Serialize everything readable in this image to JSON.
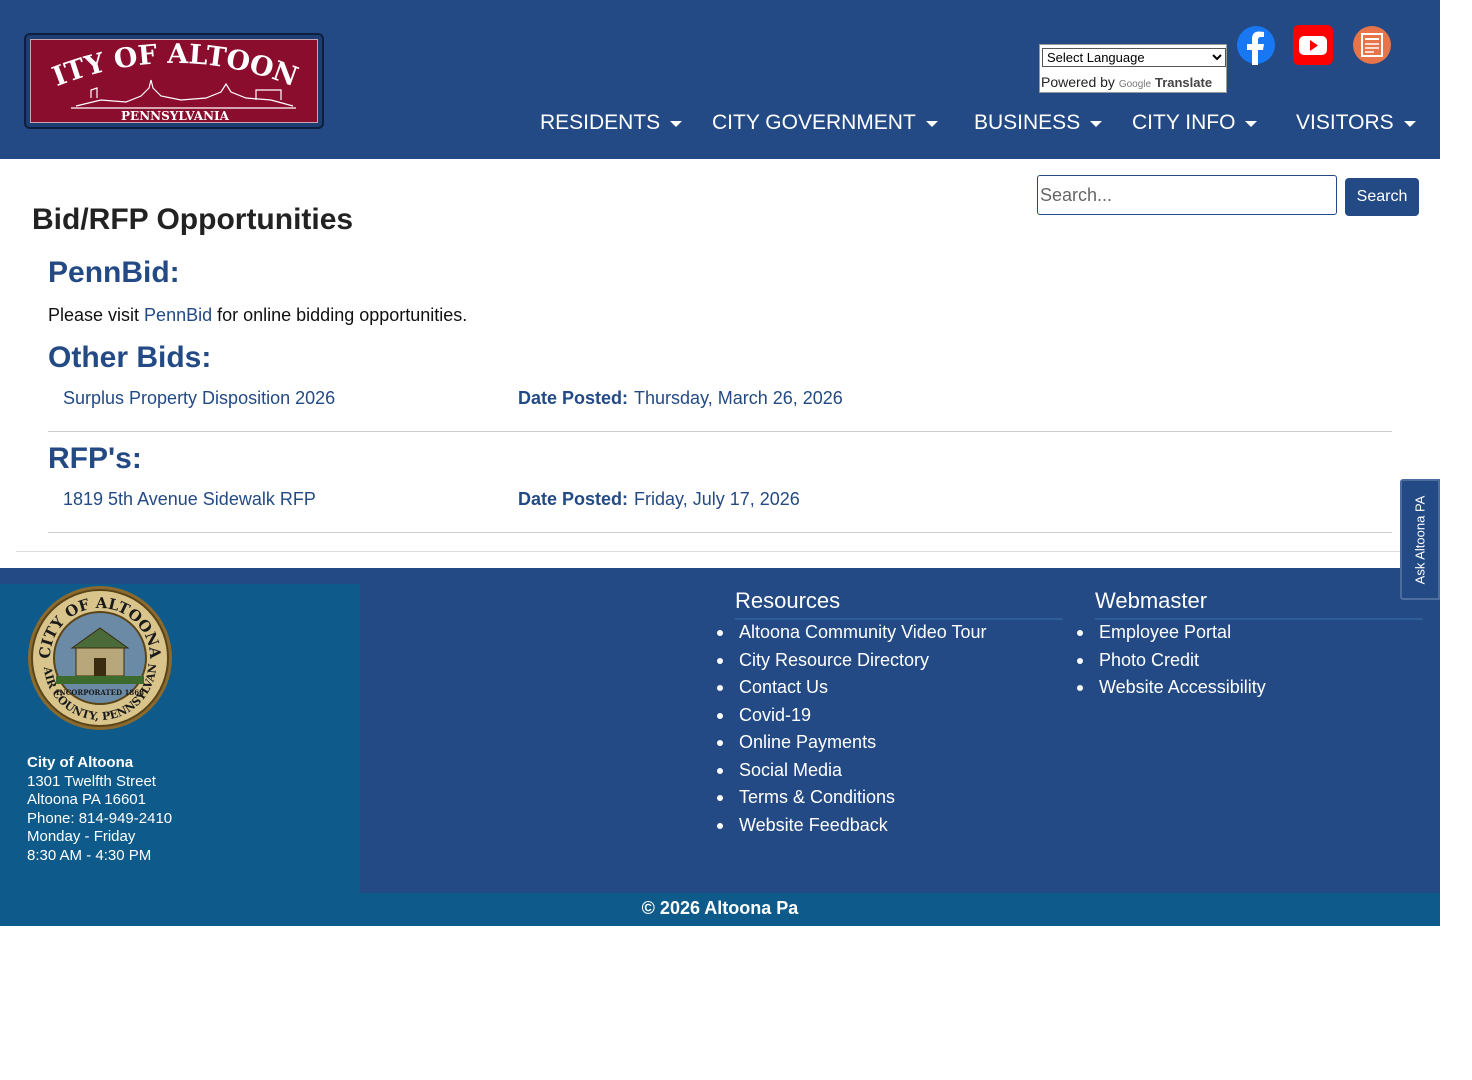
{
  "header": {
    "logo": {
      "line1": "CITY OF ALTOONA",
      "line2": "PENNSYLVANIA"
    },
    "translate": {
      "select_value": "Select Language",
      "powered_prefix": "Powered by",
      "google": "Google",
      "translate_label": "Translate"
    },
    "social_icons": [
      "facebook-icon",
      "youtube-icon",
      "newsletter-icon"
    ],
    "nav": [
      {
        "label": "RESIDENTS"
      },
      {
        "label": "CITY GOVERNMENT"
      },
      {
        "label": "BUSINESS"
      },
      {
        "label": "CITY INFO"
      },
      {
        "label": "VISITORS"
      }
    ]
  },
  "search": {
    "placeholder": "Search...",
    "button_label": "Search"
  },
  "main": {
    "page_title": "Bid/RFP Opportunities",
    "pennbid": {
      "heading": "PennBid:",
      "text_before": "Please visit ",
      "link": "PennBid",
      "text_after": " for online bidding opportunities."
    },
    "other_bids": {
      "heading": "Other Bids:",
      "items": [
        {
          "title": "Surplus Property Disposition 2026",
          "date_label": "Date Posted:",
          "date": "Thursday, March 26, 2026"
        }
      ]
    },
    "rfps": {
      "heading": "RFP's:",
      "items": [
        {
          "title": "1819 5th Avenue Sidewalk RFP",
          "date_label": "Date Posted:",
          "date": "Friday, July 17, 2026"
        }
      ]
    }
  },
  "ask_tab": {
    "label": "Ask Altoona PA"
  },
  "footer": {
    "seal": {
      "top_text": "CITY OF ALTOONA",
      "bottom_text": "BLAIR COUNTY, PENNSYLVANIA",
      "band_text": "INCORPORATED 1868"
    },
    "address": {
      "name": "City of Altoona",
      "street": "1301 Twelfth Street",
      "city": "Altoona PA 16601",
      "phone": "Phone: 814-949-2410",
      "days": "Monday - Friday",
      "hours": "8:30 AM - 4:30 PM"
    },
    "resources": {
      "heading": "Resources",
      "items": [
        "Altoona Community Video Tour",
        "City Resource Directory",
        "Contact Us",
        "Covid-19",
        "Online Payments",
        "Social Media",
        "Terms & Conditions",
        "Website Feedback"
      ]
    },
    "webmaster": {
      "heading": "Webmaster",
      "items": [
        "Employee Portal",
        "Photo Credit",
        "Website Accessibility"
      ]
    },
    "copyright": "© 2026 Altoona Pa"
  },
  "colors": {
    "brand_blue": "#234a84",
    "footer_teal": "#0e5b8b",
    "logo_red": "#8b0d2e"
  }
}
